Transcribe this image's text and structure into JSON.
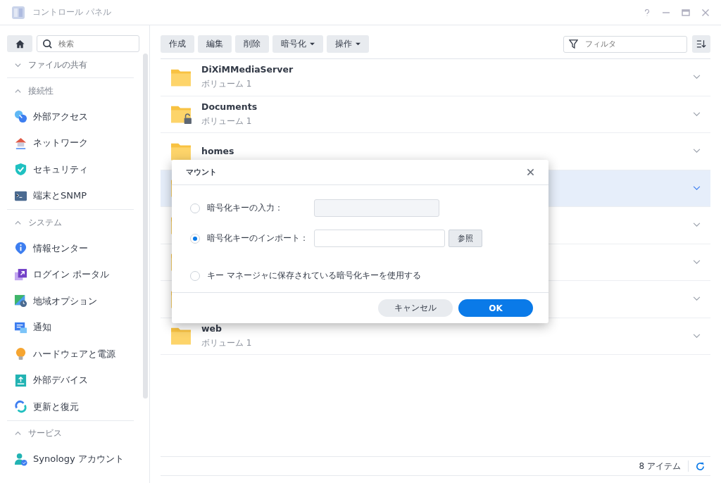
{
  "window": {
    "title": "コントロール パネル"
  },
  "sidebar": {
    "search": {
      "placeholder": "検索"
    },
    "sections": [
      {
        "title": "ファイルの共有",
        "expanded": false
      },
      {
        "title": "接続性",
        "expanded": true,
        "items": [
          {
            "label": "外部アクセス"
          },
          {
            "label": "ネットワーク"
          },
          {
            "label": "セキュリティ"
          },
          {
            "label": "端末とSNMP"
          }
        ]
      },
      {
        "title": "システム",
        "expanded": true,
        "items": [
          {
            "label": "情報センター"
          },
          {
            "label": "ログイン ポータル"
          },
          {
            "label": "地域オプション"
          },
          {
            "label": "通知"
          },
          {
            "label": "ハードウェアと電源"
          },
          {
            "label": "外部デバイス"
          },
          {
            "label": "更新と復元"
          }
        ]
      },
      {
        "title": "サービス",
        "expanded": true,
        "items": [
          {
            "label": "Synology アカウント"
          }
        ]
      }
    ]
  },
  "toolbar": {
    "buttons": [
      {
        "label": "作成",
        "dropdown": false
      },
      {
        "label": "編集",
        "dropdown": false
      },
      {
        "label": "削除",
        "dropdown": false
      },
      {
        "label": "暗号化",
        "dropdown": true
      },
      {
        "label": "操作",
        "dropdown": true
      }
    ],
    "filter": {
      "placeholder": "フィルタ"
    }
  },
  "folders": [
    {
      "name": "DiXiMMediaServer",
      "volume": "ボリューム 1",
      "locked": false,
      "selected": false
    },
    {
      "name": "Documents",
      "volume": "ボリューム 1",
      "locked": true,
      "selected": false
    },
    {
      "name": "homes",
      "locked": false,
      "selected": false
    },
    {
      "selected": true
    },
    {
      "selected": false
    },
    {
      "selected": false
    },
    {
      "selected": false
    },
    {
      "name": "web",
      "volume": "ボリューム 1",
      "locked": false,
      "selected": false
    }
  ],
  "status_bar": {
    "count": "8 アイテム"
  },
  "dialog": {
    "title": "マウント",
    "options": [
      {
        "label": "暗号化キーの入力：",
        "selected": false,
        "kind": "input",
        "disabled": true
      },
      {
        "label": "暗号化キーのインポート：",
        "selected": true,
        "kind": "file",
        "browse": "参照",
        "disabled": false
      },
      {
        "label": "キー マネージャに保存されている暗号化キーを使用する",
        "selected": false,
        "kind": "plain"
      }
    ],
    "cancel": "キャンセル",
    "ok": "OK"
  }
}
